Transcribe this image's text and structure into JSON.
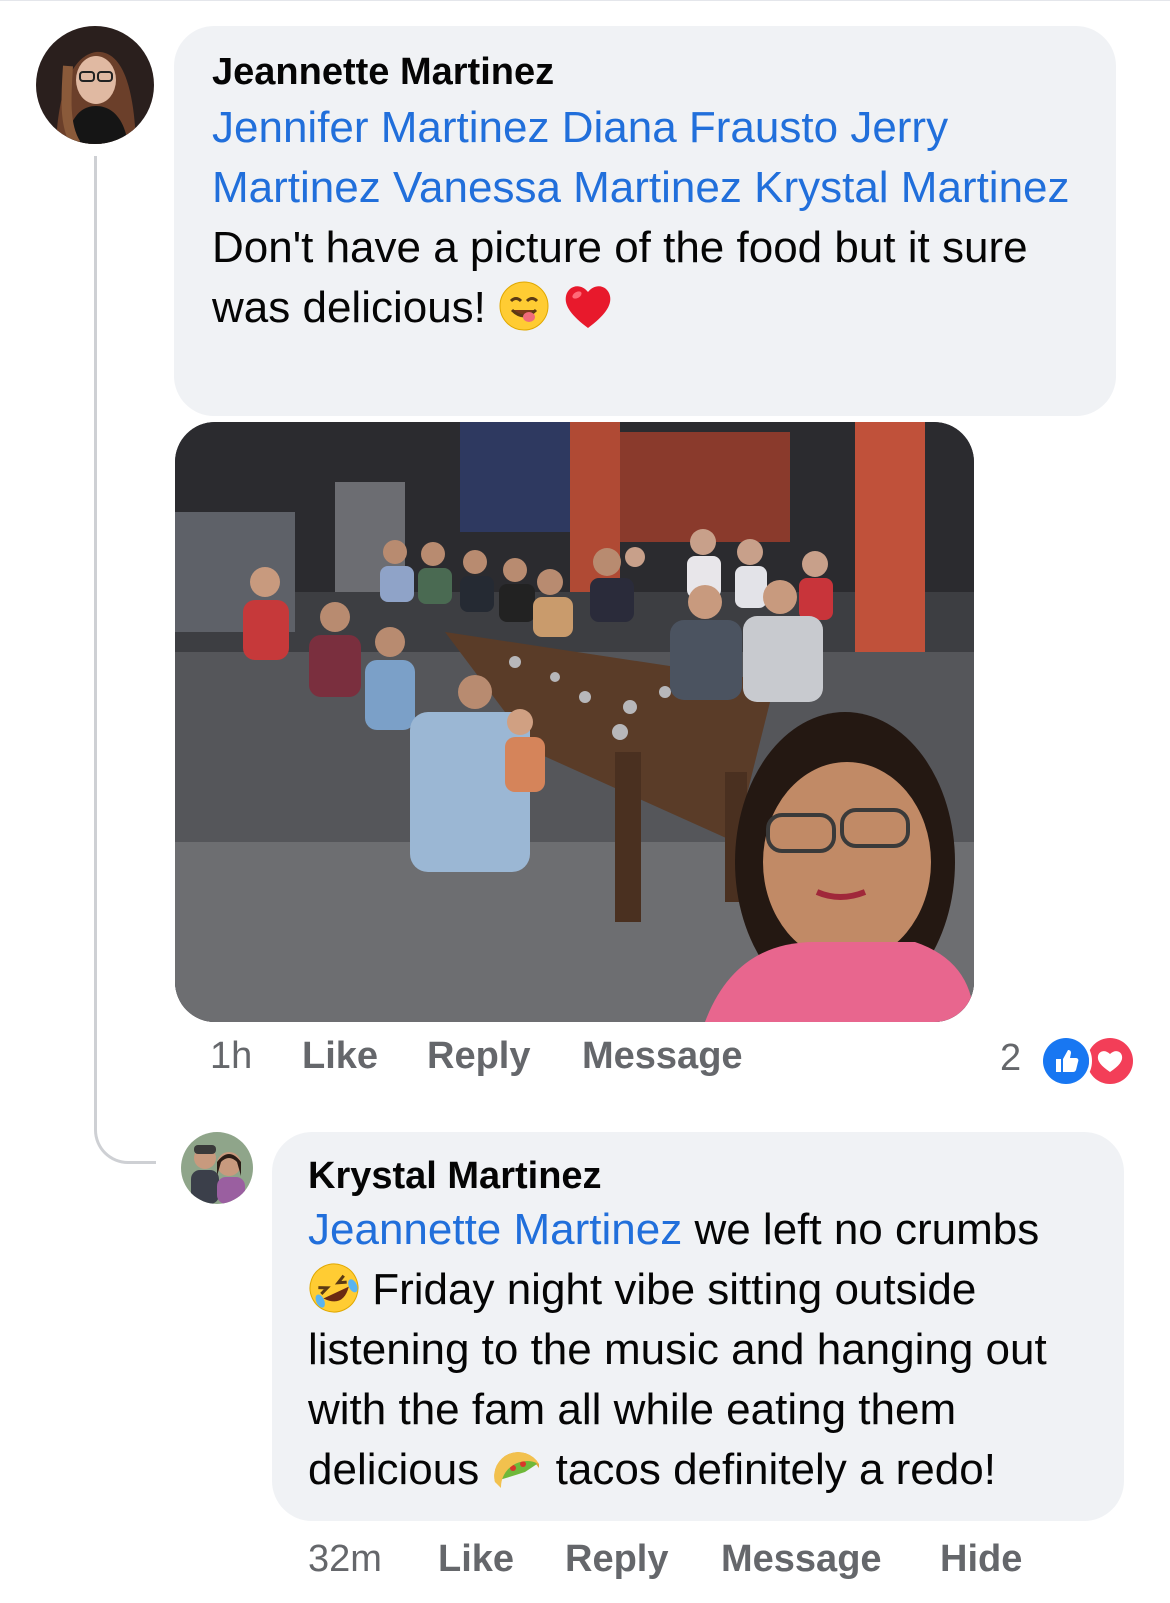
{
  "comment1": {
    "author": "Jeannette Martinez",
    "mentions": [
      "Jennifer Martinez",
      "Diana Frausto",
      "Jerry Martinez",
      "Vanessa Martinez",
      "Krystal Martinez"
    ],
    "text": "Don't have a picture of the food but it sure was delicious!",
    "emojis": [
      "face-savoring-food-emoji",
      "red-heart-emoji"
    ],
    "time": "1h",
    "like_label": "Like",
    "reply_label": "Reply",
    "message_label": "Message",
    "reaction_count": "2",
    "reactions": [
      "like-reaction-icon",
      "love-reaction-icon"
    ]
  },
  "comment2": {
    "author": "Krystal Martinez",
    "mention": "Jeannette Martinez",
    "text_part1": " we left no crumbs",
    "text_part2": " Friday night  vibe sitting outside",
    "text_part3": "listening to the music and hanging out",
    "text_part4": "with the fam all while eating them",
    "text_part5": "delicious",
    "text_part6": " tacos definitely a redo!",
    "emojis": [
      "rolling-laughing-emoji",
      "taco-emoji"
    ],
    "time": "32m",
    "like_label": "Like",
    "reply_label": "Reply",
    "message_label": "Message",
    "hide_label": "Hide"
  },
  "colors": {
    "link": "#216fdb",
    "bubble": "#f0f2f5",
    "meta": "#65676b",
    "like_blue": "#1877f2",
    "love_red": "#f33e58"
  }
}
